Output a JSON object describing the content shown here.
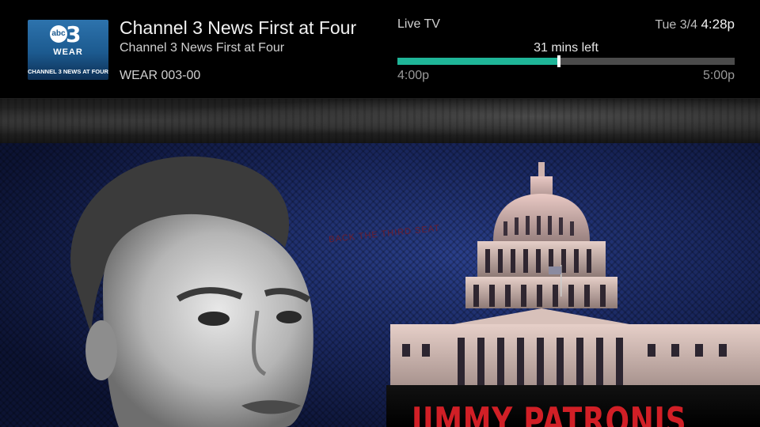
{
  "channel": {
    "logo": {
      "network": "abc",
      "number": "3",
      "call_letters": "WEAR",
      "tagline": "CHANNEL 3 NEWS AT FOUR"
    },
    "program_title": "Channel 3 News First at Four",
    "program_subtitle": "Channel 3 News First at Four",
    "channel_id": "WEAR 003-00"
  },
  "playback": {
    "source_label": "Live TV",
    "date": "Tue 3/4",
    "time": "4:28p",
    "remaining_label": "31 mins left",
    "progress_fraction": 0.48,
    "start_time": "4:00p",
    "end_time": "5:00p",
    "accent_color": "#1fb598"
  },
  "video": {
    "overlay_text": "JIMMY PATRONIS",
    "faint_text": "BACK THE THIRD SEAT"
  }
}
